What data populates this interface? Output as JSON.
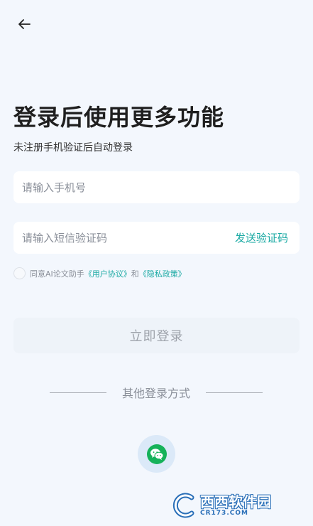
{
  "header": {
    "back_icon": "arrow-left-icon"
  },
  "page": {
    "title": "登录后使用更多功能",
    "subtitle": "未注册手机验证后自动登录"
  },
  "form": {
    "phone_placeholder": "请输入手机号",
    "code_placeholder": "请输入短信验证码",
    "send_code_label": "发送验证码"
  },
  "agreement": {
    "prefix": "同意AI论文助手",
    "user_agreement": "《用户协议》",
    "and": "和",
    "privacy_policy": "《隐私政策》"
  },
  "login_button_label": "立即登录",
  "other_login": {
    "label": "其他登录方式",
    "wechat_icon": "wechat-icon"
  },
  "watermark": {
    "main": "西西软件园",
    "sub": "CR173.COM"
  },
  "colors": {
    "background": "#f3f7fd",
    "accent": "#19a9a3",
    "wechat": "#15b25a"
  }
}
